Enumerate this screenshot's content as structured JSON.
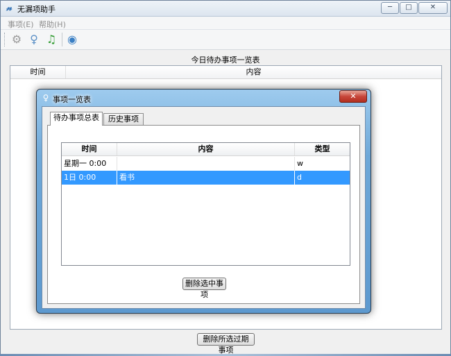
{
  "window": {
    "title": "无漏项助手",
    "minimize_glyph": "─",
    "maximize_glyph": "□",
    "close_glyph": "✕"
  },
  "menu": {
    "items": [
      {
        "label": "事项(E)"
      },
      {
        "label": "帮助(H)"
      }
    ]
  },
  "toolbar": {
    "icons": [
      "gear-icon",
      "bulb-icon",
      "music-note-icon",
      "globe-icon"
    ],
    "icon_glyphs": [
      "⚙",
      "♀",
      "♫",
      "◉"
    ]
  },
  "main": {
    "list_title": "今日待办事项一览表",
    "columns": [
      "时间",
      "内容"
    ],
    "delete_expired_label": "删除所选过期事项"
  },
  "dialog": {
    "title": "事项一览表",
    "close_glyph": "✕",
    "tabs": [
      {
        "label": "待办事项总表",
        "active": true
      },
      {
        "label": "历史事项",
        "active": false
      }
    ],
    "table": {
      "columns": [
        "时间",
        "内容",
        "类型"
      ],
      "rows": [
        {
          "time": "星期一 0:00",
          "content": "",
          "type": "w",
          "selected": false
        },
        {
          "time": "1日 0:00",
          "content": "看书",
          "type": "d",
          "selected": true
        }
      ]
    },
    "delete_selected_label": "删除选中事项"
  },
  "colors": {
    "selection": "#3399ff",
    "dialog_frame": "#6ea8d8",
    "close_red": "#c7463a"
  }
}
